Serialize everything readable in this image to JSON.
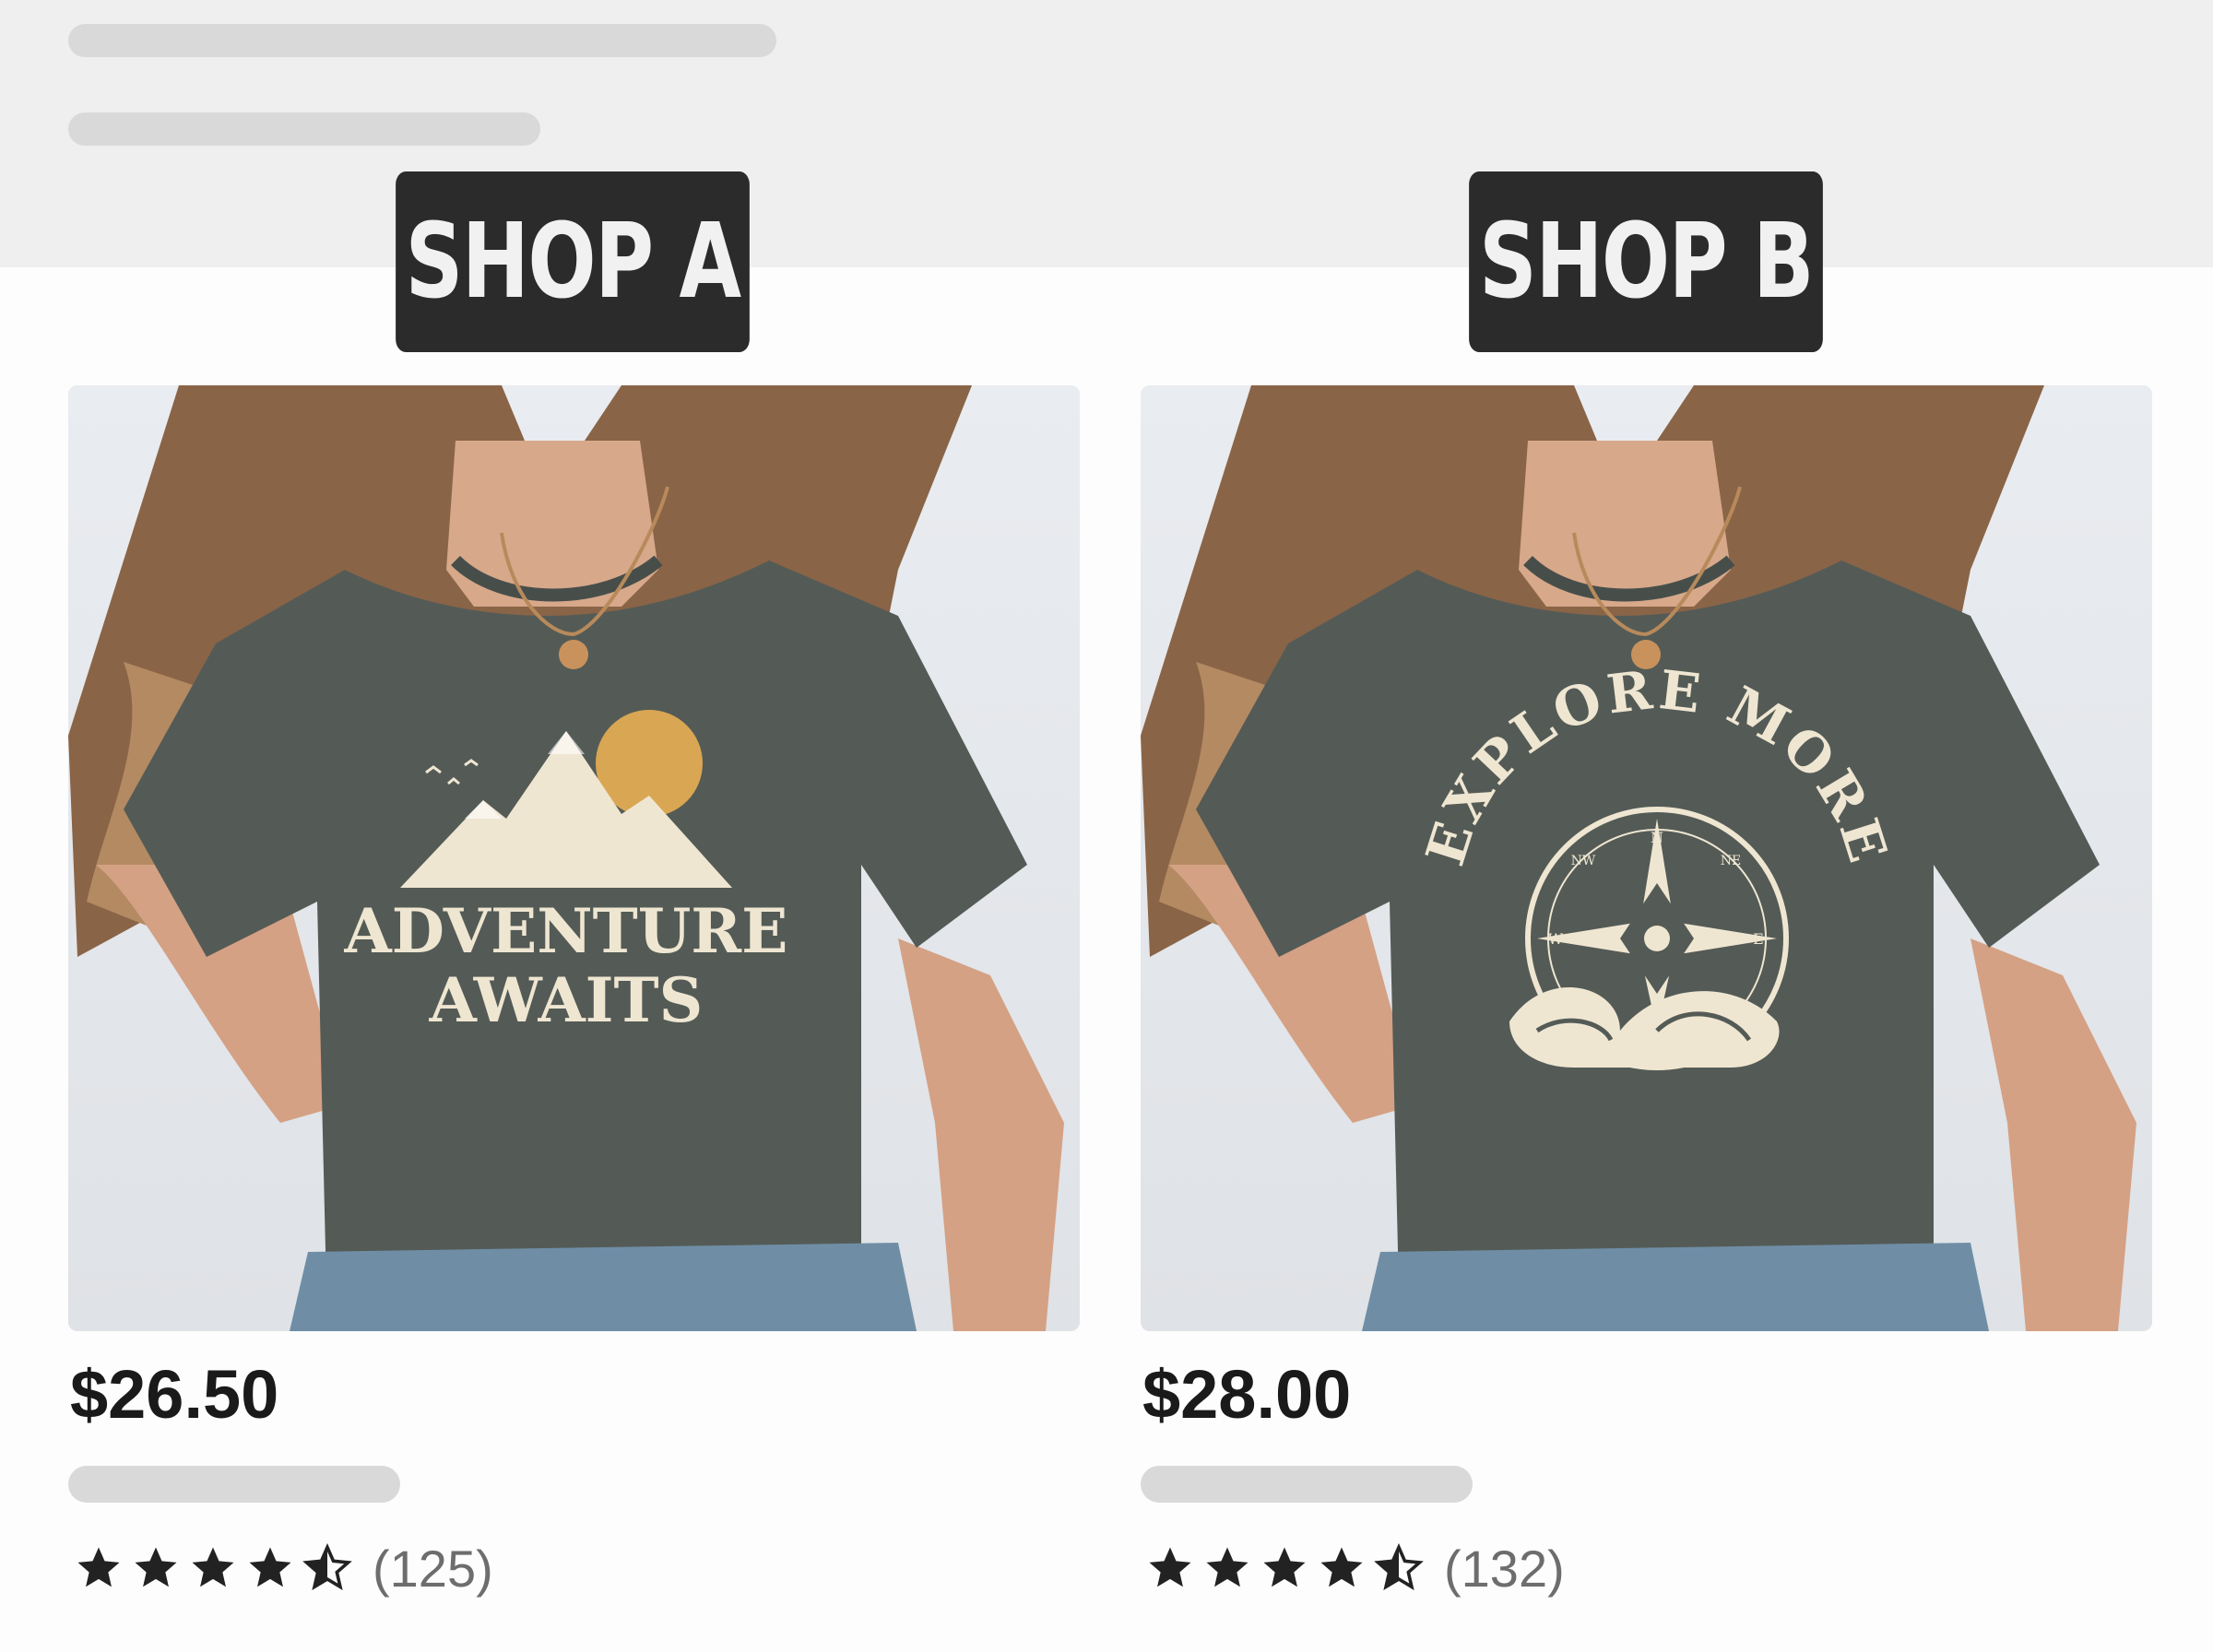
{
  "colors": {
    "label_bg": "#2b2b2b",
    "shirt": "#545b56",
    "print": "#efe6d2",
    "sun": "#d9a653",
    "skeleton": "#d9d9d9"
  },
  "shops": [
    {
      "label": "SHOP A",
      "shirt_print": {
        "line1": "ADVENTURE",
        "line2": "AWAITS",
        "graphic": "mountains-sun-icon"
      },
      "price": "$26.50",
      "rating": 4.5,
      "review_count": "(125)"
    },
    {
      "label": "SHOP B",
      "shirt_print": {
        "line1": "EXPLORE MORE",
        "compass": [
          "N",
          "NE",
          "NW",
          "E",
          "W"
        ],
        "graphic": "compass-waves-icon"
      },
      "price": "$28.00",
      "rating": 4.5,
      "review_count": "(132)"
    }
  ]
}
